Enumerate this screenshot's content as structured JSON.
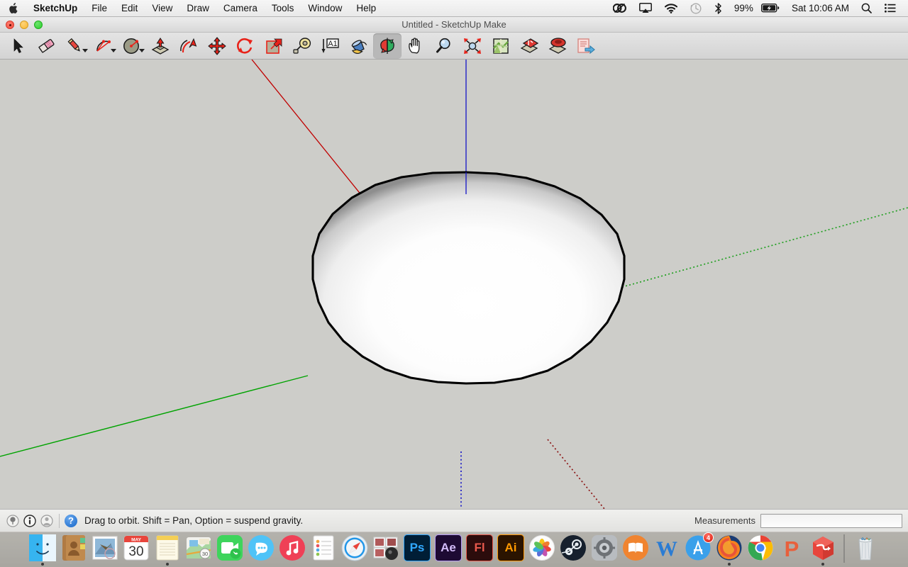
{
  "menubar": {
    "apple_icon": "apple-logo-icon",
    "app_name": "SketchUp",
    "items": [
      "File",
      "Edit",
      "View",
      "Draw",
      "Camera",
      "Tools",
      "Window",
      "Help"
    ],
    "status_icons": [
      "creative-cloud-icon",
      "airplay-icon",
      "wifi-icon",
      "time-machine-icon",
      "bluetooth-icon"
    ],
    "battery_percent": "99%",
    "battery_icon": "battery-charging-icon",
    "clock": "Sat 10:06 AM",
    "search_icon": "spotlight-search-icon",
    "notifications_icon": "notification-center-icon"
  },
  "window": {
    "title": "Untitled - SketchUp Make",
    "controls": [
      "close-button",
      "minimize-button",
      "zoom-button"
    ]
  },
  "toolbar": {
    "tools": [
      {
        "name": "select-tool",
        "label": "Select",
        "has_caret": false,
        "active": false
      },
      {
        "name": "eraser-tool",
        "label": "Eraser",
        "has_caret": false,
        "active": false
      },
      {
        "name": "line-tool",
        "label": "Line",
        "has_caret": true,
        "active": false
      },
      {
        "name": "arc-tool",
        "label": "Arc",
        "has_caret": true,
        "active": false
      },
      {
        "name": "circle-tool",
        "label": "Circle",
        "has_caret": true,
        "active": false
      },
      {
        "name": "push-pull-tool",
        "label": "Push/Pull",
        "has_caret": false,
        "active": false
      },
      {
        "name": "follow-me-tool",
        "label": "Follow Me",
        "has_caret": false,
        "active": false
      },
      {
        "name": "move-tool",
        "label": "Move",
        "has_caret": false,
        "active": false
      },
      {
        "name": "rotate-tool",
        "label": "Rotate",
        "has_caret": false,
        "active": false
      },
      {
        "name": "scale-tool",
        "label": "Scale",
        "has_caret": false,
        "active": false
      },
      {
        "name": "tape-measure-tool",
        "label": "Tape Measure",
        "has_caret": false,
        "active": false
      },
      {
        "name": "dimension-tool",
        "label": "Dimension",
        "has_caret": false,
        "active": false
      },
      {
        "name": "paint-bucket-tool",
        "label": "Paint Bucket",
        "has_caret": false,
        "active": false
      },
      {
        "name": "orbit-tool",
        "label": "Orbit",
        "has_caret": false,
        "active": true
      },
      {
        "name": "pan-tool",
        "label": "Pan",
        "has_caret": false,
        "active": false
      },
      {
        "name": "zoom-tool",
        "label": "Zoom",
        "has_caret": false,
        "active": false
      },
      {
        "name": "zoom-extents-tool",
        "label": "Zoom Extents",
        "has_caret": false,
        "active": false
      },
      {
        "name": "add-location-tool",
        "label": "Add Location",
        "has_caret": false,
        "active": false
      },
      {
        "name": "toggle-terrain-tool",
        "label": "Toggle Terrain",
        "has_caret": false,
        "active": false
      },
      {
        "name": "photo-texture-tool",
        "label": "Photo Texture",
        "has_caret": false,
        "active": false
      },
      {
        "name": "share-model-tool",
        "label": "Share Model",
        "has_caret": false,
        "active": false
      }
    ]
  },
  "viewport": {
    "background_color": "#cdcdc9",
    "model": "sphere",
    "axes": [
      {
        "name": "red-axis-solid",
        "color": "#d40000",
        "style": "solid"
      },
      {
        "name": "red-axis-dotted",
        "color": "#8c1010",
        "style": "dotted"
      },
      {
        "name": "green-axis-solid",
        "color": "#00a000",
        "style": "solid"
      },
      {
        "name": "green-axis-dotted",
        "color": "#1fa01f",
        "style": "dotted"
      },
      {
        "name": "blue-axis-solid",
        "color": "#1414c8",
        "style": "solid"
      },
      {
        "name": "blue-axis-dotted",
        "color": "#2222c8",
        "style": "dotted"
      }
    ]
  },
  "statusbar": {
    "icons": [
      "geo-location-icon",
      "info-icon",
      "person-icon"
    ],
    "help_icon": "?",
    "hint": "Drag to orbit. Shift = Pan, Option = suspend gravity.",
    "measurements_label": "Measurements",
    "measurements_value": "",
    "measurements_placeholder": ""
  },
  "dock": {
    "apps": [
      {
        "name": "finder",
        "label": "Finder",
        "running": true
      },
      {
        "name": "contacts",
        "label": "Contacts",
        "running": false
      },
      {
        "name": "mail",
        "label": "Mail",
        "running": false
      },
      {
        "name": "calendar",
        "label": "Calendar",
        "running": false,
        "month": "MAY",
        "day": "30"
      },
      {
        "name": "notes",
        "label": "Notes",
        "running": true
      },
      {
        "name": "maps",
        "label": "Maps",
        "running": false
      },
      {
        "name": "facetime",
        "label": "FaceTime",
        "running": false
      },
      {
        "name": "messages",
        "label": "Messages",
        "running": false
      },
      {
        "name": "itunes",
        "label": "iTunes",
        "running": false
      },
      {
        "name": "reminders",
        "label": "Reminders",
        "running": false
      },
      {
        "name": "safari",
        "label": "Safari",
        "running": false
      },
      {
        "name": "photo-booth",
        "label": "Photo Booth",
        "running": false
      },
      {
        "name": "photoshop",
        "label": "Ps",
        "running": false
      },
      {
        "name": "after-effects",
        "label": "Ae",
        "running": false
      },
      {
        "name": "flash",
        "label": "Fl",
        "running": false
      },
      {
        "name": "illustrator",
        "label": "Ai",
        "running": false
      },
      {
        "name": "photos",
        "label": "Photos",
        "running": false
      },
      {
        "name": "steam",
        "label": "Steam",
        "running": false
      },
      {
        "name": "system-preferences",
        "label": "System Preferences",
        "running": false
      },
      {
        "name": "ibooks",
        "label": "iBooks",
        "running": false
      },
      {
        "name": "word",
        "label": "Word",
        "running": false
      },
      {
        "name": "app-store",
        "label": "App Store",
        "running": false,
        "badge": "4"
      },
      {
        "name": "firefox",
        "label": "Firefox",
        "running": true
      },
      {
        "name": "chrome",
        "label": "Chrome",
        "running": false
      },
      {
        "name": "prezi",
        "label": "P",
        "running": false
      },
      {
        "name": "sketchup",
        "label": "SketchUp",
        "running": true
      }
    ],
    "trash": {
      "name": "trash",
      "label": "Trash"
    }
  }
}
